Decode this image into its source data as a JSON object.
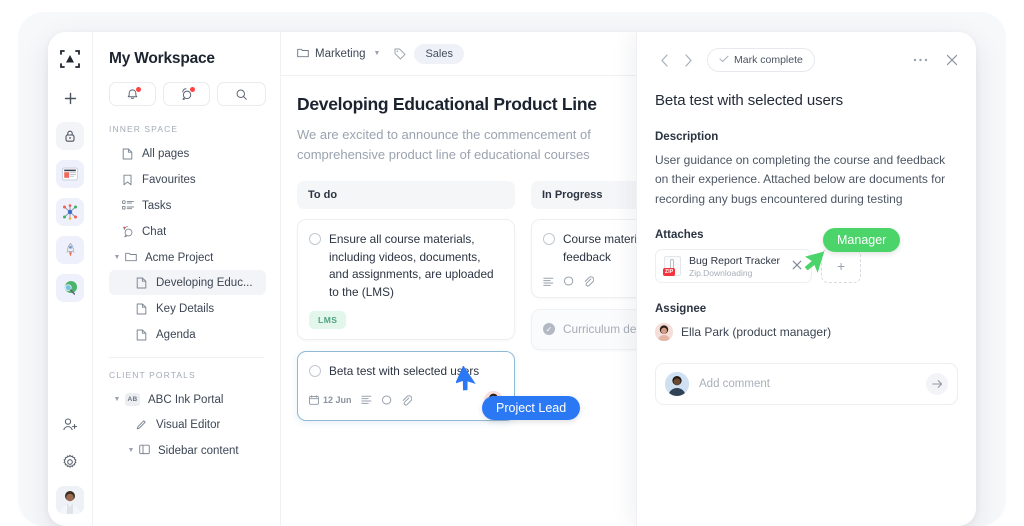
{
  "rail": {
    "logo_icon": "app-logo-icon",
    "items": [
      {
        "name": "add-button",
        "icon": "plus-icon",
        "glyph": "+"
      },
      {
        "name": "lock-button",
        "icon": "lock-icon",
        "glyph": "⌂"
      },
      {
        "name": "news-button",
        "icon": "newspaper-icon",
        "glyph": "▤"
      },
      {
        "name": "network-button",
        "icon": "network-icon",
        "glyph": "⁂"
      },
      {
        "name": "rocket-button",
        "icon": "rocket-icon",
        "glyph": "▲"
      },
      {
        "name": "explore-button",
        "icon": "globe-search-icon",
        "glyph": "●"
      }
    ],
    "bottom_items": [
      {
        "name": "invite-members-button",
        "icon": "person-add-icon"
      },
      {
        "name": "settings-button",
        "icon": "gear-icon"
      }
    ],
    "avatar_name": "user-avatar"
  },
  "sidebar": {
    "workspace_title": "My Workspace",
    "actions": [
      {
        "name": "notifications-button",
        "icon": "bell-icon",
        "badge": true
      },
      {
        "name": "messages-button",
        "icon": "chat-icon",
        "badge": true
      },
      {
        "name": "search-button",
        "icon": "search-icon",
        "badge": false
      }
    ],
    "inner_space_label": "INNER SPACE",
    "inner_items": [
      {
        "label": "All pages",
        "icon": "page-icon"
      },
      {
        "label": "Favourites",
        "icon": "bookmark-icon"
      },
      {
        "label": "Tasks",
        "icon": "list-icon"
      },
      {
        "label": "Chat",
        "icon": "chat-icon",
        "badge": true
      }
    ],
    "project": {
      "label": "Acme Project",
      "icon": "folder-icon",
      "expanded": true,
      "children": [
        {
          "label": "Developing Educ...",
          "icon": "page-icon",
          "active": true
        },
        {
          "label": "Key Details",
          "icon": "page-icon",
          "active": false
        },
        {
          "label": "Agenda",
          "icon": "page-icon",
          "active": false
        }
      ]
    },
    "client_portals_label": "CLIENT PORTALS",
    "portal": {
      "label": "ABC Ink Portal",
      "badge_text": "AB",
      "expanded": true,
      "children": [
        {
          "label": "Visual Editor",
          "icon": "pencil-icon"
        },
        {
          "label": "Sidebar content",
          "icon": "sidebar-icon",
          "expanded": true
        }
      ]
    }
  },
  "main": {
    "breadcrumb": {
      "folder_icon": "folder-icon",
      "label": "Marketing",
      "caret": "▾"
    },
    "tag_icon": "tag-icon",
    "tag_label": "Sales",
    "page_title": "Developing Educational Product Line",
    "page_lede": "We are excited to announce the commencement of comprehensive product line of educational courses",
    "columns": [
      {
        "title": "To do",
        "cards": [
          {
            "title": "Ensure all course materials, including videos, documents, and assignments, are uploaded to the (LMS)",
            "tag": "LMS",
            "state": "open",
            "selected": false
          },
          {
            "title": "Beta test with selected users",
            "state": "open",
            "selected": true,
            "date": "12 Jun",
            "meta_icons": [
              "calendar-icon",
              "description-icon",
              "comment-icon",
              "attachment-icon"
            ],
            "avatar": "assignee-avatar"
          }
        ]
      },
      {
        "title": "In Progress",
        "cards": [
          {
            "title": "Course materials Review and feedback",
            "state": "open",
            "selected": false,
            "meta_icons": [
              "description-icon",
              "comment-icon",
              "attachment-icon"
            ]
          },
          {
            "title": "Curriculum design",
            "state": "done",
            "selected": false
          }
        ]
      }
    ]
  },
  "panel": {
    "prev_icon": "chevron-left-icon",
    "next_icon": "chevron-right-icon",
    "mark_complete_label": "Mark complete",
    "mark_complete_icon": "check-icon",
    "more_icon": "ellipsis-icon",
    "close_icon": "close-icon",
    "title": "Beta test with selected users",
    "description_label": "Description",
    "description_text": "User guidance on completing the course and feedback on their experience. Attached below are documents for recording any bugs encountered during testing",
    "attaches_label": "Attaches",
    "attachment": {
      "name": "Bug Report Tracker",
      "status": "Zip.Downloading",
      "badge": "ZIP",
      "remove_icon": "close-icon"
    },
    "add_attachment_label": "+",
    "assignee_label": "Assignee",
    "assignee_name": "Ella Park (product manager)",
    "comment_placeholder": "Add comment",
    "send_icon": "arrow-right-icon"
  },
  "cursors": [
    {
      "name": "manager-cursor",
      "label": "Manager",
      "color": "#4ad46a"
    },
    {
      "name": "project-lead-cursor",
      "label": "Project Lead",
      "color": "#2b78f5"
    }
  ]
}
